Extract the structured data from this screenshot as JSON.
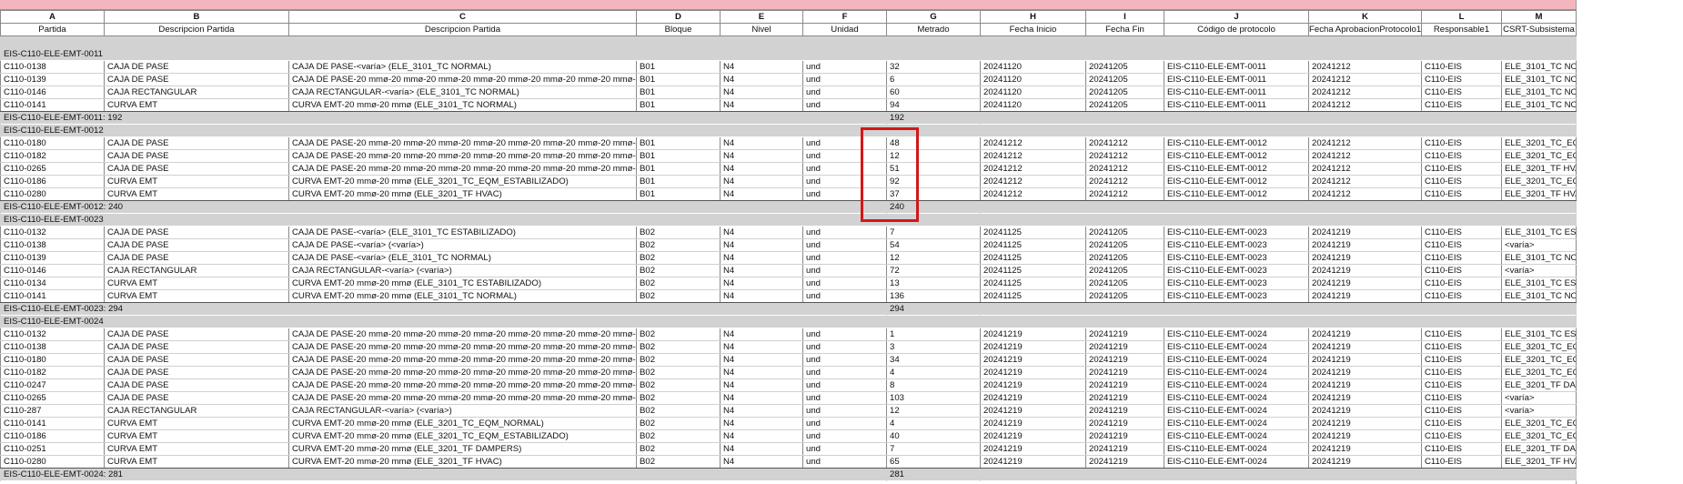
{
  "columns": [
    {
      "letter": "A",
      "title": "Partida"
    },
    {
      "letter": "B",
      "title": "Descripcion Partida"
    },
    {
      "letter": "C",
      "title": "Descripcion Partida"
    },
    {
      "letter": "D",
      "title": "Bloque"
    },
    {
      "letter": "E",
      "title": "Nivel"
    },
    {
      "letter": "F",
      "title": "Unidad"
    },
    {
      "letter": "G",
      "title": "Metrado"
    },
    {
      "letter": "H",
      "title": "Fecha Inicio"
    },
    {
      "letter": "I",
      "title": "Fecha Fin"
    },
    {
      "letter": "J",
      "title": "Código de protocolo"
    },
    {
      "letter": "K",
      "title": "Fecha AprobacionProtocolo1"
    },
    {
      "letter": "L",
      "title": "Responsable1"
    },
    {
      "letter": "M",
      "title": "CSRT-Subsistema"
    }
  ],
  "groups": [
    {
      "name": "EIS-C110-ELE-EMT-0011",
      "summary_label": "EIS-C110-ELE-EMT-0011: 192",
      "total": "192",
      "rows": [
        [
          "C110-0138",
          "CAJA DE PASE",
          "CAJA DE PASE-<varía> (ELE_3101_TC NORMAL)",
          "B01",
          "N4",
          "und",
          "32",
          "20241120",
          "20241205",
          "EIS-C110-ELE-EMT-0011",
          "20241212",
          "C110-EIS",
          "ELE_3101_TC NOR"
        ],
        [
          "C110-0139",
          "CAJA DE PASE",
          "CAJA DE PASE-20 mmø-20 mmø-20 mmø-20 mmø-20 mmø-20 mmø-20 mmø-20 mmø-20",
          "B01",
          "N4",
          "und",
          "6",
          "20241120",
          "20241205",
          "EIS-C110-ELE-EMT-0011",
          "20241212",
          "C110-EIS",
          "ELE_3101_TC NOR"
        ],
        [
          "C110-0146",
          "CAJA RECTANGULAR",
          "CAJA RECTANGULAR-<varía> (ELE_3101_TC NORMAL)",
          "B01",
          "N4",
          "und",
          "60",
          "20241120",
          "20241205",
          "EIS-C110-ELE-EMT-0011",
          "20241212",
          "C110-EIS",
          "ELE_3101_TC NOR"
        ],
        [
          "C110-0141",
          "CURVA EMT",
          "CURVA EMT-20 mmø-20 mmø (ELE_3101_TC NORMAL)",
          "B01",
          "N4",
          "und",
          "94",
          "20241120",
          "20241205",
          "EIS-C110-ELE-EMT-0011",
          "20241212",
          "C110-EIS",
          "ELE_3101_TC NOR"
        ]
      ]
    },
    {
      "name": "EIS-C110-ELE-EMT-0012",
      "summary_label": "EIS-C110-ELE-EMT-0012: 240",
      "total": "240",
      "rows": [
        [
          "C110-0180",
          "CAJA DE PASE",
          "CAJA DE PASE-20 mmø-20 mmø-20 mmø-20 mmø-20 mmø-20 mmø-20 mmø-20 mmø-20",
          "B01",
          "N4",
          "und",
          "48",
          "20241212",
          "20241212",
          "EIS-C110-ELE-EMT-0012",
          "20241212",
          "C110-EIS",
          "ELE_3201_TC_EQ"
        ],
        [
          "C110-0182",
          "CAJA DE PASE",
          "CAJA DE PASE-20 mmø-20 mmø-20 mmø-20 mmø-20 mmø-20 mmø-20 mmø-20 mmø-20",
          "B01",
          "N4",
          "und",
          "12",
          "20241212",
          "20241212",
          "EIS-C110-ELE-EMT-0012",
          "20241212",
          "C110-EIS",
          "ELE_3201_TC_EQ"
        ],
        [
          "C110-0265",
          "CAJA DE PASE",
          "CAJA DE PASE-20 mmø-20 mmø-20 mmø-20 mmø-20 mmø-20 mmø-20 mmø-20 mmø-20",
          "B01",
          "N4",
          "und",
          "51",
          "20241212",
          "20241212",
          "EIS-C110-ELE-EMT-0012",
          "20241212",
          "C110-EIS",
          "ELE_3201_TF HVA"
        ],
        [
          "C110-0186",
          "CURVA EMT",
          "CURVA EMT-20 mmø-20 mmø (ELE_3201_TC_EQM_ESTABILIZADO)",
          "B01",
          "N4",
          "und",
          "92",
          "20241212",
          "20241212",
          "EIS-C110-ELE-EMT-0012",
          "20241212",
          "C110-EIS",
          "ELE_3201_TC_EQ"
        ],
        [
          "C110-0280",
          "CURVA EMT",
          "CURVA EMT-20 mmø-20 mmø (ELE_3201_TF HVAC)",
          "B01",
          "N4",
          "und",
          "37",
          "20241212",
          "20241212",
          "EIS-C110-ELE-EMT-0012",
          "20241212",
          "C110-EIS",
          "ELE_3201_TF HVA"
        ]
      ]
    },
    {
      "name": "EIS-C110-ELE-EMT-0023",
      "summary_label": "EIS-C110-ELE-EMT-0023: 294",
      "total": "294",
      "rows": [
        [
          "C110-0132",
          "CAJA DE PASE",
          "CAJA DE PASE-<varía> (ELE_3101_TC ESTABILIZADO)",
          "B02",
          "N4",
          "und",
          "7",
          "20241125",
          "20241205",
          "EIS-C110-ELE-EMT-0023",
          "20241219",
          "C110-EIS",
          "ELE_3101_TC EST"
        ],
        [
          "C110-0138",
          "CAJA DE PASE",
          "CAJA DE PASE-<varía> (<varía>)",
          "B02",
          "N4",
          "und",
          "54",
          "20241125",
          "20241205",
          "EIS-C110-ELE-EMT-0023",
          "20241219",
          "C110-EIS",
          "<varía>"
        ],
        [
          "C110-0139",
          "CAJA DE PASE",
          "CAJA DE PASE-<varía> (ELE_3101_TC NORMAL)",
          "B02",
          "N4",
          "und",
          "12",
          "20241125",
          "20241205",
          "EIS-C110-ELE-EMT-0023",
          "20241219",
          "C110-EIS",
          "ELE_3101_TC NOR"
        ],
        [
          "C110-0146",
          "CAJA RECTANGULAR",
          "CAJA RECTANGULAR-<varía> (<varía>)",
          "B02",
          "N4",
          "und",
          "72",
          "20241125",
          "20241205",
          "EIS-C110-ELE-EMT-0023",
          "20241219",
          "C110-EIS",
          "<varía>"
        ],
        [
          "C110-0134",
          "CURVA EMT",
          "CURVA EMT-20 mmø-20 mmø (ELE_3101_TC ESTABILIZADO)",
          "B02",
          "N4",
          "und",
          "13",
          "20241125",
          "20241205",
          "EIS-C110-ELE-EMT-0023",
          "20241219",
          "C110-EIS",
          "ELE_3101_TC EST"
        ],
        [
          "C110-0141",
          "CURVA EMT",
          "CURVA EMT-20 mmø-20 mmø (ELE_3101_TC NORMAL)",
          "B02",
          "N4",
          "und",
          "136",
          "20241125",
          "20241205",
          "EIS-C110-ELE-EMT-0023",
          "20241219",
          "C110-EIS",
          "ELE_3101_TC NOR"
        ]
      ]
    },
    {
      "name": "EIS-C110-ELE-EMT-0024",
      "summary_label": "EIS-C110-ELE-EMT-0024: 281",
      "total": "281",
      "rows": [
        [
          "C110-0132",
          "CAJA DE PASE",
          "CAJA DE PASE-20 mmø-20 mmø-20 mmø-20 mmø-20 mmø-20 mmø-20 mmø-20 mmø-20",
          "B02",
          "N4",
          "und",
          "1",
          "20241219",
          "20241219",
          "EIS-C110-ELE-EMT-0024",
          "20241219",
          "C110-EIS",
          "ELE_3101_TC EST"
        ],
        [
          "C110-0138",
          "CAJA DE PASE",
          "CAJA DE PASE-20 mmø-20 mmø-20 mmø-20 mmø-20 mmø-20 mmø-20 mmø-20 mmø-20",
          "B02",
          "N4",
          "und",
          "3",
          "20241219",
          "20241219",
          "EIS-C110-ELE-EMT-0024",
          "20241219",
          "C110-EIS",
          "ELE_3201_TC_EQ"
        ],
        [
          "C110-0180",
          "CAJA DE PASE",
          "CAJA DE PASE-20 mmø-20 mmø-20 mmø-20 mmø-20 mmø-20 mmø-20 mmø-20 mmø-20",
          "B02",
          "N4",
          "und",
          "34",
          "20241219",
          "20241219",
          "EIS-C110-ELE-EMT-0024",
          "20241219",
          "C110-EIS",
          "ELE_3201_TC_EQ"
        ],
        [
          "C110-0182",
          "CAJA DE PASE",
          "CAJA DE PASE-20 mmø-20 mmø-20 mmø-20 mmø-20 mmø-20 mmø-20 mmø-20 mmø-20",
          "B02",
          "N4",
          "und",
          "4",
          "20241219",
          "20241219",
          "EIS-C110-ELE-EMT-0024",
          "20241219",
          "C110-EIS",
          "ELE_3201_TC_EQ"
        ],
        [
          "C110-0247",
          "CAJA DE PASE",
          "CAJA DE PASE-20 mmø-20 mmø-20 mmø-20 mmø-20 mmø-20 mmø-20 mmø-20 mmø-20",
          "B02",
          "N4",
          "und",
          "8",
          "20241219",
          "20241219",
          "EIS-C110-ELE-EMT-0024",
          "20241219",
          "C110-EIS",
          "ELE_3201_TF DAM"
        ],
        [
          "C110-0265",
          "CAJA DE PASE",
          "CAJA DE PASE-20 mmø-20 mmø-20 mmø-20 mmø-20 mmø-20 mmø-20 mmø-20 mmø-20",
          "B02",
          "N4",
          "und",
          "103",
          "20241219",
          "20241219",
          "EIS-C110-ELE-EMT-0024",
          "20241219",
          "C110-EIS",
          "<varía>"
        ],
        [
          "C110-287",
          "CAJA RECTANGULAR",
          "CAJA RECTANGULAR-<varía> (<varía>)",
          "B02",
          "N4",
          "und",
          "12",
          "20241219",
          "20241219",
          "EIS-C110-ELE-EMT-0024",
          "20241219",
          "C110-EIS",
          "<varía>"
        ],
        [
          "C110-0141",
          "CURVA EMT",
          "CURVA EMT-20 mmø-20 mmø (ELE_3201_TC_EQM_NORMAL)",
          "B02",
          "N4",
          "und",
          "4",
          "20241219",
          "20241219",
          "EIS-C110-ELE-EMT-0024",
          "20241219",
          "C110-EIS",
          "ELE_3201_TC_EQ"
        ],
        [
          "C110-0186",
          "CURVA EMT",
          "CURVA EMT-20 mmø-20 mmø (ELE_3201_TC_EQM_ESTABILIZADO)",
          "B02",
          "N4",
          "und",
          "40",
          "20241219",
          "20241219",
          "EIS-C110-ELE-EMT-0024",
          "20241219",
          "C110-EIS",
          "ELE_3201_TC_EQ"
        ],
        [
          "C110-0251",
          "CURVA EMT",
          "CURVA EMT-20 mmø-20 mmø (ELE_3201_TF DAMPERS)",
          "B02",
          "N4",
          "und",
          "7",
          "20241219",
          "20241219",
          "EIS-C110-ELE-EMT-0024",
          "20241219",
          "C110-EIS",
          "ELE_3201_TF DAM"
        ],
        [
          "C110-0280",
          "CURVA EMT",
          "CURVA EMT-20 mmø-20 mmø (ELE_3201_TF HVAC)",
          "B02",
          "N4",
          "und",
          "65",
          "20241219",
          "20241219",
          "EIS-C110-ELE-EMT-0024",
          "20241219",
          "C110-EIS",
          "ELE_3201_TF HVA"
        ]
      ]
    }
  ],
  "highlight": {
    "color": "#d01818"
  }
}
